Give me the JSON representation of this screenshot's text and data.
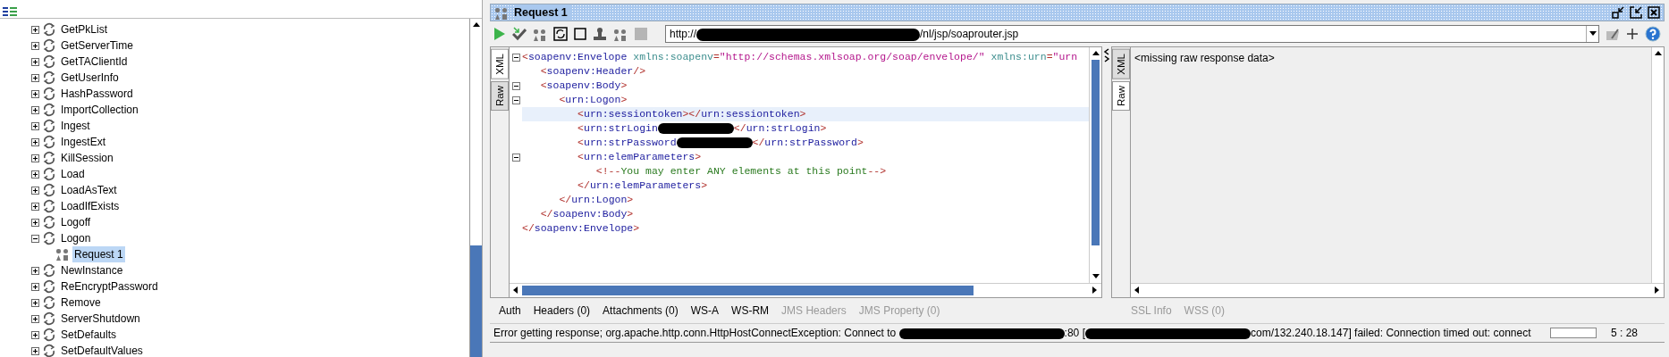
{
  "tree": {
    "items": [
      {
        "label": "GetPkList",
        "expanded": false,
        "selected": false
      },
      {
        "label": "GetServerTime",
        "expanded": false,
        "selected": false
      },
      {
        "label": "GetTAClientId",
        "expanded": false,
        "selected": false
      },
      {
        "label": "GetUserInfo",
        "expanded": false,
        "selected": false
      },
      {
        "label": "HashPassword",
        "expanded": false,
        "selected": false
      },
      {
        "label": "ImportCollection",
        "expanded": false,
        "selected": false
      },
      {
        "label": "Ingest",
        "expanded": false,
        "selected": false
      },
      {
        "label": "IngestExt",
        "expanded": false,
        "selected": false
      },
      {
        "label": "KillSession",
        "expanded": false,
        "selected": false
      },
      {
        "label": "Load",
        "expanded": false,
        "selected": false
      },
      {
        "label": "LoadAsText",
        "expanded": false,
        "selected": false
      },
      {
        "label": "LoadIfExists",
        "expanded": false,
        "selected": false
      },
      {
        "label": "Logoff",
        "expanded": false,
        "selected": false
      },
      {
        "label": "Logon",
        "expanded": true,
        "selected": false,
        "children": [
          {
            "label": "Request 1",
            "selected": true
          }
        ]
      },
      {
        "label": "NewInstance",
        "expanded": false,
        "selected": false
      },
      {
        "label": "ReEncryptPassword",
        "expanded": false,
        "selected": false
      },
      {
        "label": "Remove",
        "expanded": false,
        "selected": false
      },
      {
        "label": "ServerShutdown",
        "expanded": false,
        "selected": false
      },
      {
        "label": "SetDefaults",
        "expanded": false,
        "selected": false
      },
      {
        "label": "SetDefaultValues",
        "expanded": false,
        "selected": false
      }
    ]
  },
  "request": {
    "title": "Request 1",
    "url": {
      "prefix": "http://",
      "suffix": "/nl/jsp/soaprouter.jsp"
    },
    "editor_tabs": [
      {
        "label": "XML",
        "selected": true
      },
      {
        "label": "Raw",
        "selected": false
      }
    ],
    "lines": [
      {
        "fold": true,
        "highlighted": false,
        "tokens": [
          {
            "kind": "punct",
            "text": "<"
          },
          {
            "kind": "tag",
            "text": "soapenv:Envelope"
          },
          {
            "kind": "attr",
            "text": " xmlns:soapenv"
          },
          {
            "kind": "punct",
            "text": "="
          },
          {
            "kind": "value",
            "text": "\"http://schemas.xmlsoap.org/soap/envelope/\""
          },
          {
            "kind": "attr",
            "text": " xmlns:urn"
          },
          {
            "kind": "punct",
            "text": "="
          },
          {
            "kind": "value",
            "text": "\"urn"
          }
        ]
      },
      {
        "fold": false,
        "highlighted": false,
        "tokens": [
          {
            "kind": "punct",
            "text": "   <"
          },
          {
            "kind": "tag",
            "text": "soapenv:Header"
          },
          {
            "kind": "punct",
            "text": "/>"
          }
        ]
      },
      {
        "fold": true,
        "highlighted": false,
        "tokens": [
          {
            "kind": "punct",
            "text": "   <"
          },
          {
            "kind": "tag",
            "text": "soapenv:Body"
          },
          {
            "kind": "punct",
            "text": ">"
          }
        ]
      },
      {
        "fold": true,
        "highlighted": false,
        "tokens": [
          {
            "kind": "punct",
            "text": "      <"
          },
          {
            "kind": "tag",
            "text": "urn:Logon"
          },
          {
            "kind": "punct",
            "text": ">"
          }
        ]
      },
      {
        "fold": false,
        "highlighted": true,
        "tokens": [
          {
            "kind": "punct",
            "text": "         <"
          },
          {
            "kind": "tag",
            "text": "urn:sessiontoken"
          },
          {
            "kind": "punct",
            "text": "></"
          },
          {
            "kind": "tag",
            "text": "urn:sessiontoken"
          },
          {
            "kind": "punct",
            "text": ">"
          }
        ]
      },
      {
        "fold": false,
        "highlighted": false,
        "tokens": [
          {
            "kind": "punct",
            "text": "         <"
          },
          {
            "kind": "tag",
            "text": "urn:strLogin"
          },
          {
            "kind": "redacted"
          },
          {
            "kind": "punct",
            "text": "</"
          },
          {
            "kind": "tag",
            "text": "urn:strLogin"
          },
          {
            "kind": "punct",
            "text": ">"
          }
        ]
      },
      {
        "fold": false,
        "highlighted": false,
        "tokens": [
          {
            "kind": "punct",
            "text": "         <"
          },
          {
            "kind": "tag",
            "text": "urn:strPassword"
          },
          {
            "kind": "redacted"
          },
          {
            "kind": "punct",
            "text": "</"
          },
          {
            "kind": "tag",
            "text": "urn:strPassword"
          },
          {
            "kind": "punct",
            "text": ">"
          }
        ]
      },
      {
        "fold": true,
        "highlighted": false,
        "tokens": [
          {
            "kind": "punct",
            "text": "         <"
          },
          {
            "kind": "tag",
            "text": "urn:elemParameters"
          },
          {
            "kind": "punct",
            "text": ">"
          }
        ]
      },
      {
        "fold": false,
        "highlighted": false,
        "tokens": [
          {
            "kind": "punct",
            "text": "            <!--"
          },
          {
            "kind": "comment",
            "text": "You may enter ANY elements at this point"
          },
          {
            "kind": "punct",
            "text": "-->"
          }
        ]
      },
      {
        "fold": false,
        "highlighted": false,
        "tokens": [
          {
            "kind": "punct",
            "text": "         </"
          },
          {
            "kind": "tag",
            "text": "urn:elemParameters"
          },
          {
            "kind": "punct",
            "text": ">"
          }
        ]
      },
      {
        "fold": false,
        "highlighted": false,
        "tokens": [
          {
            "kind": "punct",
            "text": "      </"
          },
          {
            "kind": "tag",
            "text": "urn:Logon"
          },
          {
            "kind": "punct",
            "text": ">"
          }
        ]
      },
      {
        "fold": false,
        "highlighted": false,
        "tokens": [
          {
            "kind": "punct",
            "text": "   </"
          },
          {
            "kind": "tag",
            "text": "soapenv:Body"
          },
          {
            "kind": "punct",
            "text": ">"
          }
        ]
      },
      {
        "fold": false,
        "highlighted": false,
        "tokens": [
          {
            "kind": "punct",
            "text": "</"
          },
          {
            "kind": "tag",
            "text": "soapenv:Envelope"
          },
          {
            "kind": "punct",
            "text": ">"
          }
        ]
      }
    ],
    "request_tabs": [
      {
        "label": "Auth",
        "disabled": false
      },
      {
        "label": "Headers (0)",
        "disabled": false
      },
      {
        "label": "Attachments (0)",
        "disabled": false
      },
      {
        "label": "WS-A",
        "disabled": false
      },
      {
        "label": "WS-RM",
        "disabled": false
      },
      {
        "label": "JMS Headers",
        "disabled": true
      },
      {
        "label": "JMS Property (0)",
        "disabled": true
      }
    ]
  },
  "response": {
    "editor_tabs": [
      {
        "label": "XML",
        "selected": false
      },
      {
        "label": "Raw",
        "selected": true
      }
    ],
    "text": "<missing raw response data>",
    "response_tabs": [
      {
        "label": "SSL Info",
        "disabled": true
      },
      {
        "label": "WSS (0)",
        "disabled": true
      }
    ]
  },
  "status_bar": {
    "message_parts": [
      {
        "kind": "text",
        "text": "Error getting response; org.apache.http.conn.HttpHostConnectException: Connect to "
      },
      {
        "kind": "redacted"
      },
      {
        "kind": "text",
        "text": ":80 ["
      },
      {
        "kind": "redacted"
      },
      {
        "kind": "text",
        "text": "com/132.240.18.147] failed: Connection timed out: connect"
      }
    ],
    "progress": {
      "level": 0
    },
    "position": "5 : 28"
  }
}
